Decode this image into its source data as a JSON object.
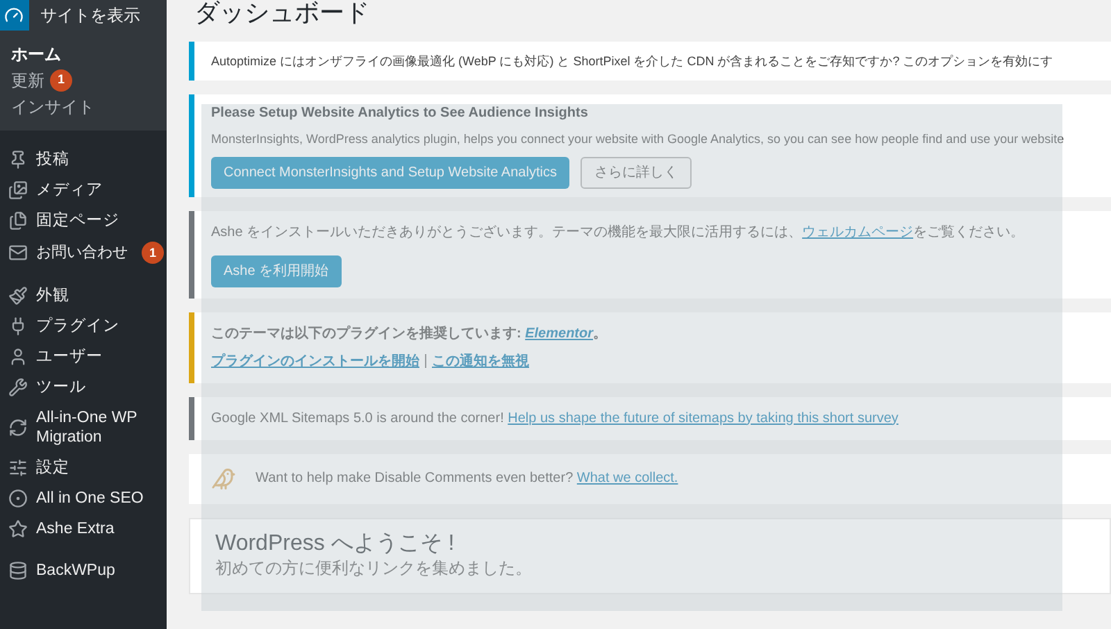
{
  "admin_bar": {
    "flyout": "サイトを表示"
  },
  "sidebar": {
    "submenu": [
      {
        "label": "ホーム",
        "selected": true
      },
      {
        "label": "更新",
        "selected": false,
        "badge": "1"
      },
      {
        "label": "インサイト",
        "selected": false
      }
    ],
    "items": [
      {
        "label": "投稿"
      },
      {
        "label": "メディア"
      },
      {
        "label": "固定ページ"
      },
      {
        "label": "お問い合わせ",
        "badge": "1"
      },
      {
        "label": "外観"
      },
      {
        "label": "プラグイン"
      },
      {
        "label": "ユーザー"
      },
      {
        "label": "ツール"
      },
      {
        "label": "All-in-One WP Migration"
      },
      {
        "label": "設定"
      },
      {
        "label": "All in One SEO"
      },
      {
        "label": "Ashe Extra"
      },
      {
        "label": "BackWPup"
      }
    ]
  },
  "page_title": "ダッシュボード",
  "notices": [
    {
      "kind": "plain",
      "text": "Autoptimize にはオンザフライの画像最適化 (WebP にも対応) と ShortPixel を介した CDN が含まれることをご存知ですか? このオプションを有効にす"
    },
    {
      "kind": "analytics",
      "title": "Please Setup Website Analytics to See Audience Insights",
      "text": "MonsterInsights, WordPress analytics plugin, helps you connect your website with Google Analytics, so you can see how people find and use your website",
      "primary": "Connect MonsterInsights and Setup Website Analytics",
      "secondary": "さらに詳しく"
    },
    {
      "kind": "theme",
      "text": "Ashe をインストールいただきありがとうございます。テーマの機能を最大限に活用するには、",
      "link": "ウェルカムページ",
      "after": "をご覧ください。",
      "button": "Ashe を利用開始"
    },
    {
      "kind": "plugins",
      "text": "このテーマは以下のプラグインを推奨しています: ",
      "link": "Elementor",
      "after": "。",
      "actions": [
        "プラグインのインストールを開始",
        "この通知を無視"
      ]
    },
    {
      "kind": "sitemap",
      "text": "Google XML Sitemaps 5.0 is around the corner! ",
      "link": "Help us shape the future of sitemaps by taking this short survey"
    },
    {
      "kind": "comments",
      "text": "Want to help make Disable Comments even better? ",
      "link": "What we collect."
    }
  ],
  "welcome": {
    "title": "WordPress へようこそ !",
    "subtitle": "初めての方に便利なリンクを集めました。"
  }
}
